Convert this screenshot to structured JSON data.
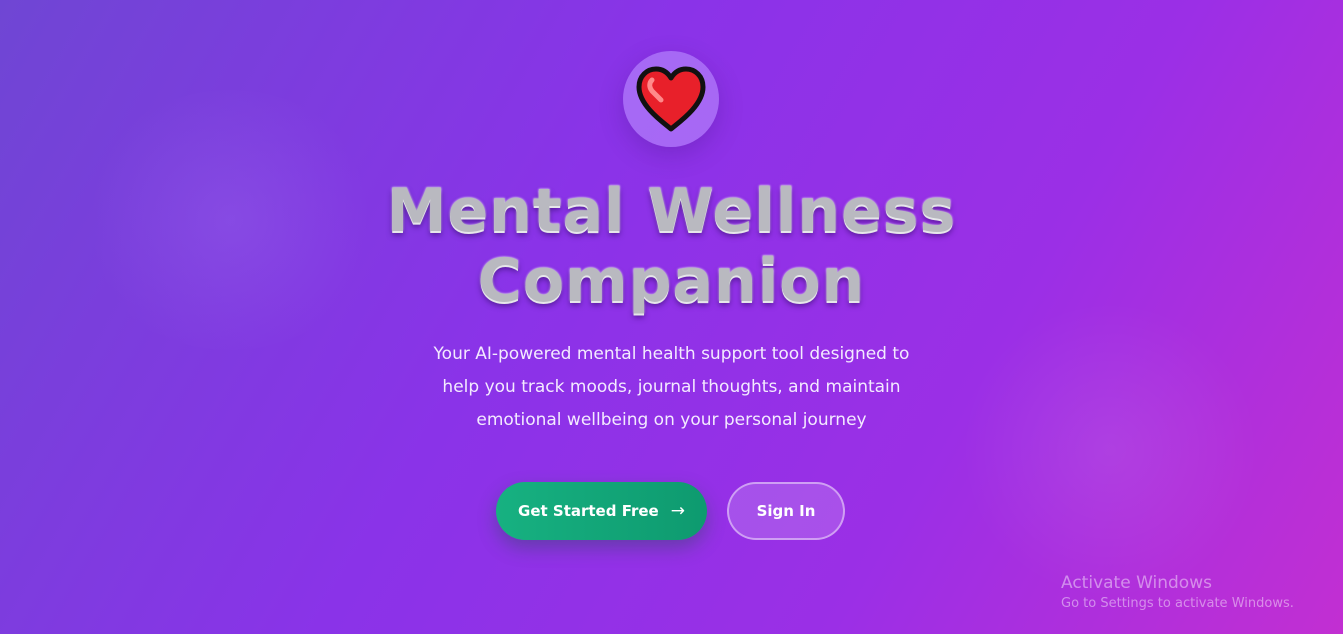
{
  "hero": {
    "logo_icon": "heart-icon",
    "title_line1": "Mental Wellness",
    "title_line2": "Companion",
    "description_line1": "Your AI-powered mental health support tool designed to",
    "description_line2": "help you track moods, journal thoughts, and maintain",
    "description_line3": "emotional wellbeing on your personal journey"
  },
  "actions": {
    "primary_label": "Get Started Free",
    "primary_arrow": "→",
    "secondary_label": "Sign In"
  },
  "watermark": {
    "title": "Activate Windows",
    "subtitle": "Go to Settings to activate Windows."
  },
  "colors": {
    "background_start": "#6f46d4",
    "background_end": "#c22fd2",
    "primary_button": "#14a878",
    "heart": "#e8202a"
  }
}
